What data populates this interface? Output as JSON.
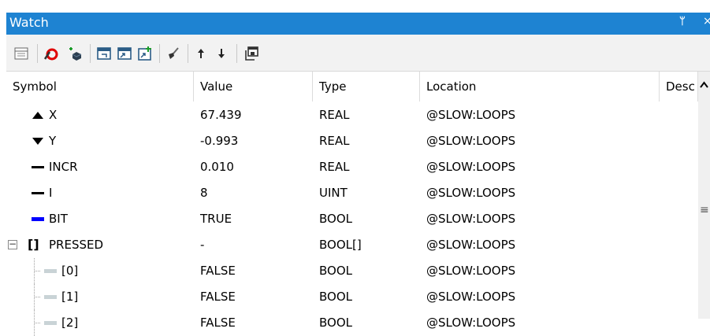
{
  "window": {
    "title": "Watch",
    "pin_glyph": "ᛘ",
    "close_glyph": "×"
  },
  "toolbar": {
    "buttons": [
      {
        "name": "view-list-icon"
      },
      {
        "name": "remove-breakpoint-icon"
      },
      {
        "name": "add-symbol-icon"
      },
      {
        "name": "import-icon"
      },
      {
        "name": "export-icon"
      },
      {
        "name": "add-variable-icon"
      },
      {
        "name": "clean-icon"
      },
      {
        "name": "move-up-icon"
      },
      {
        "name": "move-down-icon"
      },
      {
        "name": "copy-window-icon"
      }
    ]
  },
  "columns": {
    "symbol": "Symbol",
    "value": "Value",
    "type": "Type",
    "location": "Location",
    "description": "Desc"
  },
  "rows": [
    {
      "symbol": "X",
      "value": "67.439",
      "type": "REAL",
      "location": "@SLOW:LOOPS",
      "icon": "triangle-up-icon"
    },
    {
      "symbol": "Y",
      "value": "-0.993",
      "type": "REAL",
      "location": "@SLOW:LOOPS",
      "icon": "triangle-down-icon"
    },
    {
      "symbol": "INCR",
      "value": "0.010",
      "type": "REAL",
      "location": "@SLOW:LOOPS",
      "icon": "line-icon"
    },
    {
      "symbol": "I",
      "value": "8",
      "type": "UINT",
      "location": "@SLOW:LOOPS",
      "icon": "line-icon"
    },
    {
      "symbol": "BIT",
      "value": "TRUE",
      "type": "BOOL",
      "location": "@SLOW:LOOPS",
      "icon": "blue-bar-icon"
    },
    {
      "symbol": "PRESSED",
      "value": "-",
      "type": "BOOL[]",
      "location": "@SLOW:LOOPS",
      "icon": "array-brackets-icon",
      "bracket_glyph": "[]"
    },
    {
      "symbol": "[0]",
      "value": "FALSE",
      "type": "BOOL",
      "location": "@SLOW:LOOPS",
      "icon": "gray-bar-icon"
    },
    {
      "symbol": "[1]",
      "value": "FALSE",
      "type": "BOOL",
      "location": "@SLOW:LOOPS",
      "icon": "gray-bar-icon"
    },
    {
      "symbol": "[2]",
      "value": "FALSE",
      "type": "BOOL",
      "location": "@SLOW:LOOPS",
      "icon": "gray-bar-icon"
    }
  ],
  "tree": {
    "expander_glyph": "−"
  },
  "scrollbar": {
    "grip_glyph": "≡"
  },
  "colors": {
    "titlebar": "#1e83d2",
    "bool_true": "#0000ff",
    "bool_false": "#c9d3d6"
  }
}
